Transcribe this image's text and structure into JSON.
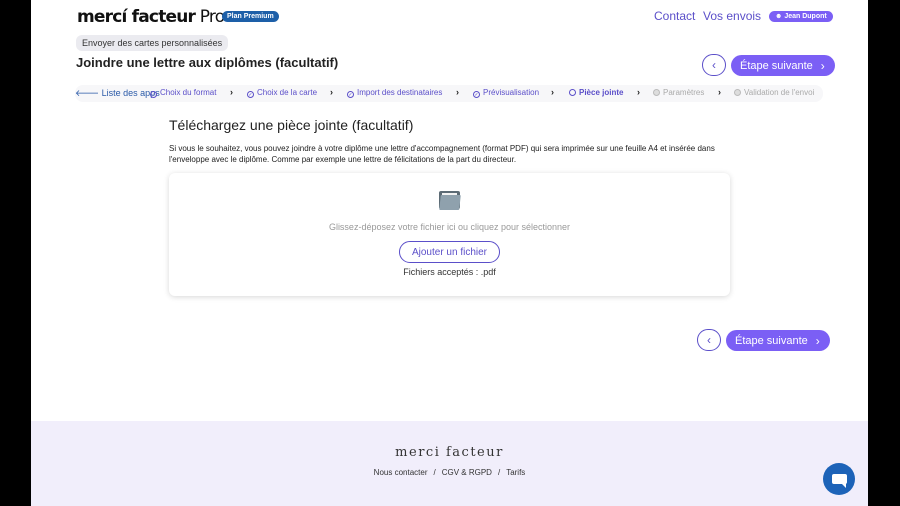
{
  "header": {
    "logo_main": "mercí facteur",
    "logo_suffix": " Pro",
    "plan_badge": "Plan Premium",
    "nav": {
      "contact": "Contact",
      "envois": "Vos envois"
    },
    "user": "Jean Dupont"
  },
  "context_tag": "Envoyer des cartes personnalisées",
  "page_title": "Joindre une lettre aux diplômes (facultatif)",
  "navigation": {
    "prev_icon": "chevron-left-icon",
    "next_label": "Étape suivante",
    "next_icon": "chevron-right-icon"
  },
  "steps": {
    "back_label": "Liste des apps",
    "items": [
      {
        "label": "Choix du format",
        "state": "done"
      },
      {
        "label": "Choix de la carte",
        "state": "done"
      },
      {
        "label": "Import des destinataires",
        "state": "done"
      },
      {
        "label": "Prévisualisation",
        "state": "done"
      },
      {
        "label": "Pièce jointe",
        "state": "current"
      },
      {
        "label": "Paramètres",
        "state": "todo"
      },
      {
        "label": "Validation de l'envoi",
        "state": "todo"
      }
    ]
  },
  "upload": {
    "title": "Téléchargez une pièce jointe (facultatif)",
    "description": "Si vous le souhaitez, vous pouvez joindre à votre diplôme une lettre d'accompagnement (format PDF) qui sera imprimée sur une feuille A4 et insérée dans l'enveloppe avec le diplôme. Comme par exemple une lettre de félicitations de la part du directeur.",
    "icon": "folder-icon",
    "drop_hint": "Glissez-déposez votre fichier ici ou cliquez pour sélectionner",
    "button_label": "Ajouter un fichier",
    "accepted": "Fichiers acceptés : .pdf"
  },
  "footer": {
    "logo": "merci facteur",
    "links": [
      "Nous contacter",
      "CGV & RGPD",
      "Tarifs"
    ],
    "separator": "/"
  },
  "colors": {
    "accent": "#7b5ff5",
    "link": "#5b4fc9",
    "footer_bg": "#f1eefb",
    "chat": "#1d63b8"
  }
}
